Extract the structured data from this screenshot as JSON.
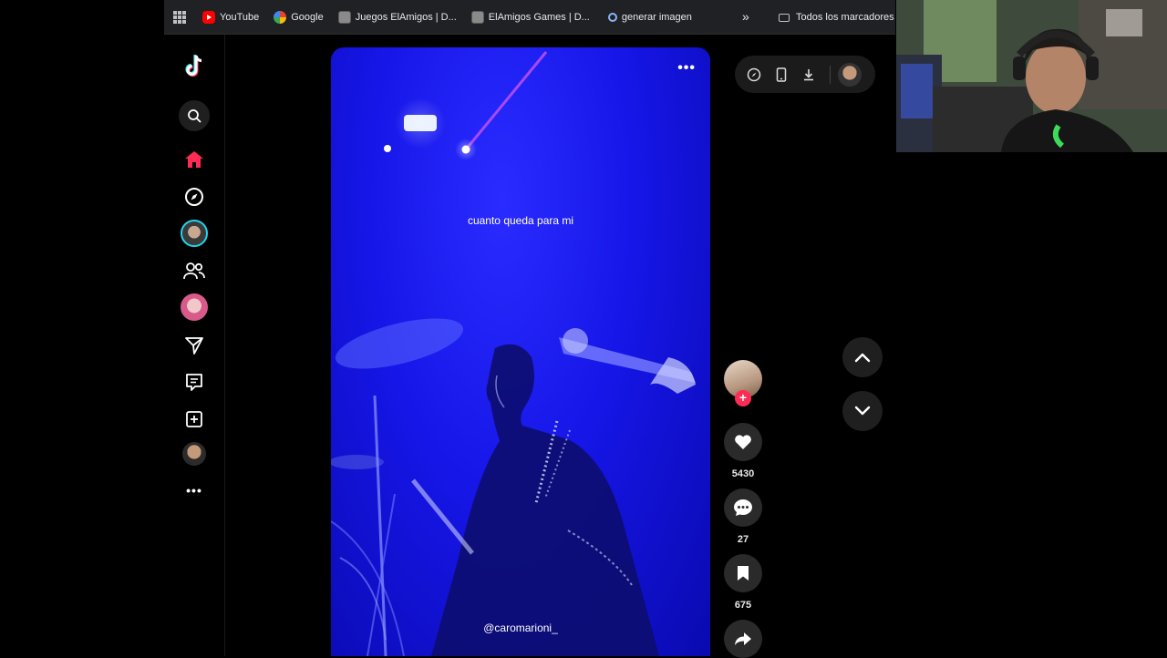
{
  "bookmarks": {
    "items": [
      {
        "label": "YouTube",
        "icon": "youtube-icon"
      },
      {
        "label": "Google",
        "icon": "google-icon"
      },
      {
        "label": "Juegos ElAmigos | D...",
        "icon": "site-thumbnail-icon"
      },
      {
        "label": "ElAmigos Games | D...",
        "icon": "site-thumbnail-icon"
      },
      {
        "label": "generar imagen",
        "icon": "search-icon"
      }
    ],
    "overflow": "»",
    "all_bookmarks": "Todos los marcadores"
  },
  "tiktok": {
    "brand_color": "#fe2c55",
    "nav_icons": [
      "tiktok-logo-icon",
      "search-icon",
      "home-icon",
      "explore-icon",
      "live-avatar",
      "following-icon",
      "friend-avatar",
      "messages-icon",
      "inbox-icon",
      "upload-icon",
      "profile-avatar",
      "more-icon"
    ],
    "more": "•••"
  },
  "video": {
    "caption": "cuanto queda para mi",
    "watermark": "@caromarioni_",
    "more": "•••"
  },
  "actions": {
    "likes": "5430",
    "comments": "27",
    "saves": "675"
  }
}
